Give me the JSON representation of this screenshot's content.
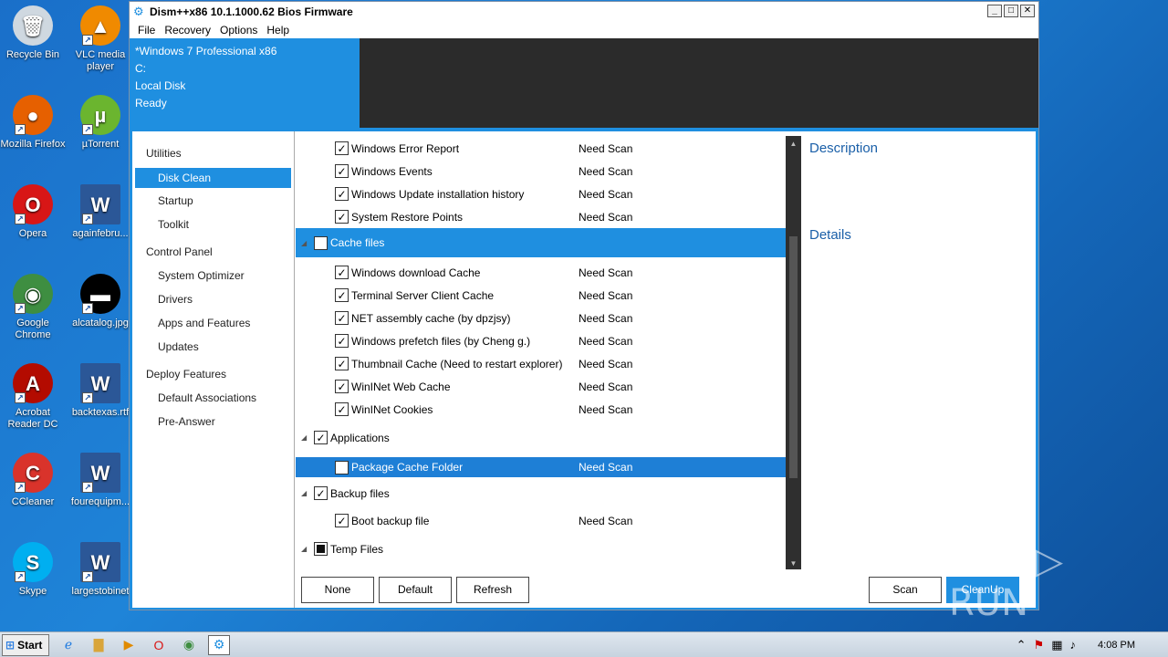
{
  "desktop": {
    "icons": [
      {
        "name": "recycle-bin",
        "label": "Recycle Bin",
        "glyph": "🗑",
        "color": "#cfd8e0"
      },
      {
        "name": "vlc",
        "label": "VLC media player",
        "glyph": "▲",
        "color": "#f08a00"
      },
      {
        "name": "firefox",
        "label": "Mozilla Firefox",
        "glyph": "●",
        "color": "#e66000"
      },
      {
        "name": "utorrent",
        "label": "µTorrent",
        "glyph": "µ",
        "color": "#6bb52f"
      },
      {
        "name": "opera",
        "label": "Opera",
        "glyph": "O",
        "color": "#d81616"
      },
      {
        "name": "doc-againfebru",
        "label": "againfebru...",
        "glyph": "W",
        "color": "#2b5797"
      },
      {
        "name": "chrome",
        "label": "Google Chrome",
        "glyph": "◉",
        "color": "#3e8e41"
      },
      {
        "name": "img-alcatalog",
        "label": "alcatalog.jpg",
        "glyph": "▬",
        "color": "#000000"
      },
      {
        "name": "acrobat",
        "label": "Acrobat Reader DC",
        "glyph": "A",
        "color": "#b30b00"
      },
      {
        "name": "doc-backtexas",
        "label": "backtexas.rtf",
        "glyph": "W",
        "color": "#2b5797"
      },
      {
        "name": "ccleaner",
        "label": "CCleaner",
        "glyph": "C",
        "color": "#d9332b"
      },
      {
        "name": "doc-fourequip",
        "label": "fourequipm...",
        "glyph": "W",
        "color": "#2b5797"
      },
      {
        "name": "skype",
        "label": "Skype",
        "glyph": "S",
        "color": "#00aff0"
      },
      {
        "name": "doc-largestob",
        "label": "largestobinet",
        "glyph": "W",
        "color": "#2b5797"
      }
    ]
  },
  "window": {
    "title": "Dism++x86 10.1.1000.62 Bios Firmware",
    "buttons": {
      "min": "_",
      "max": "□",
      "close": "✕"
    },
    "menu": [
      "File",
      "Recovery",
      "Options",
      "Help"
    ],
    "info": {
      "os": "*Windows 7 Professional x86",
      "drive": "C:",
      "disk": "Local Disk",
      "status": "Ready"
    }
  },
  "nav": {
    "utilities": "Utilities",
    "disk_clean": "Disk Clean",
    "startup": "Startup",
    "toolkit": "Toolkit",
    "control_panel": "Control Panel",
    "system_optimizer": "System Optimizer",
    "drivers": "Drivers",
    "apps_features": "Apps and Features",
    "updates": "Updates",
    "deploy_features": "Deploy Features",
    "default_assoc": "Default Associations",
    "pre_answer": "Pre-Answer"
  },
  "list": {
    "need_scan": "Need Scan",
    "rows": [
      {
        "label": "Windows Error Report",
        "status": "Need Scan"
      },
      {
        "label": "Windows Events",
        "status": "Need Scan"
      },
      {
        "label": "Windows Update installation history",
        "status": "Need Scan"
      },
      {
        "label": "System Restore Points",
        "status": "Need Scan"
      },
      {
        "label": "Cache files"
      },
      {
        "label": "Windows download Cache",
        "status": "Need Scan"
      },
      {
        "label": "Terminal Server Client Cache",
        "status": "Need Scan"
      },
      {
        "label": "NET assembly cache (by dpzjsy)",
        "status": "Need Scan"
      },
      {
        "label": "Windows prefetch files (by Cheng g.)",
        "status": "Need Scan"
      },
      {
        "label": "Thumbnail Cache (Need to restart explorer)",
        "status": "Need Scan"
      },
      {
        "label": "WinINet Web Cache",
        "status": "Need Scan"
      },
      {
        "label": "WinINet Cookies",
        "status": "Need Scan"
      },
      {
        "label": "Applications"
      },
      {
        "label": "Package Cache Folder",
        "status": "Need Scan"
      },
      {
        "label": "Backup files"
      },
      {
        "label": "Boot backup file",
        "status": "Need Scan"
      },
      {
        "label": "Temp Files"
      }
    ]
  },
  "side": {
    "description": "Description",
    "details": "Details"
  },
  "buttons": {
    "none": "None",
    "default": "Default",
    "refresh": "Refresh",
    "scan": "Scan",
    "cleanup": "CleanUp"
  },
  "watermark": {
    "text": "ANY ▷ RUN"
  },
  "taskbar": {
    "start": "Start",
    "clock": "4:08 PM"
  }
}
